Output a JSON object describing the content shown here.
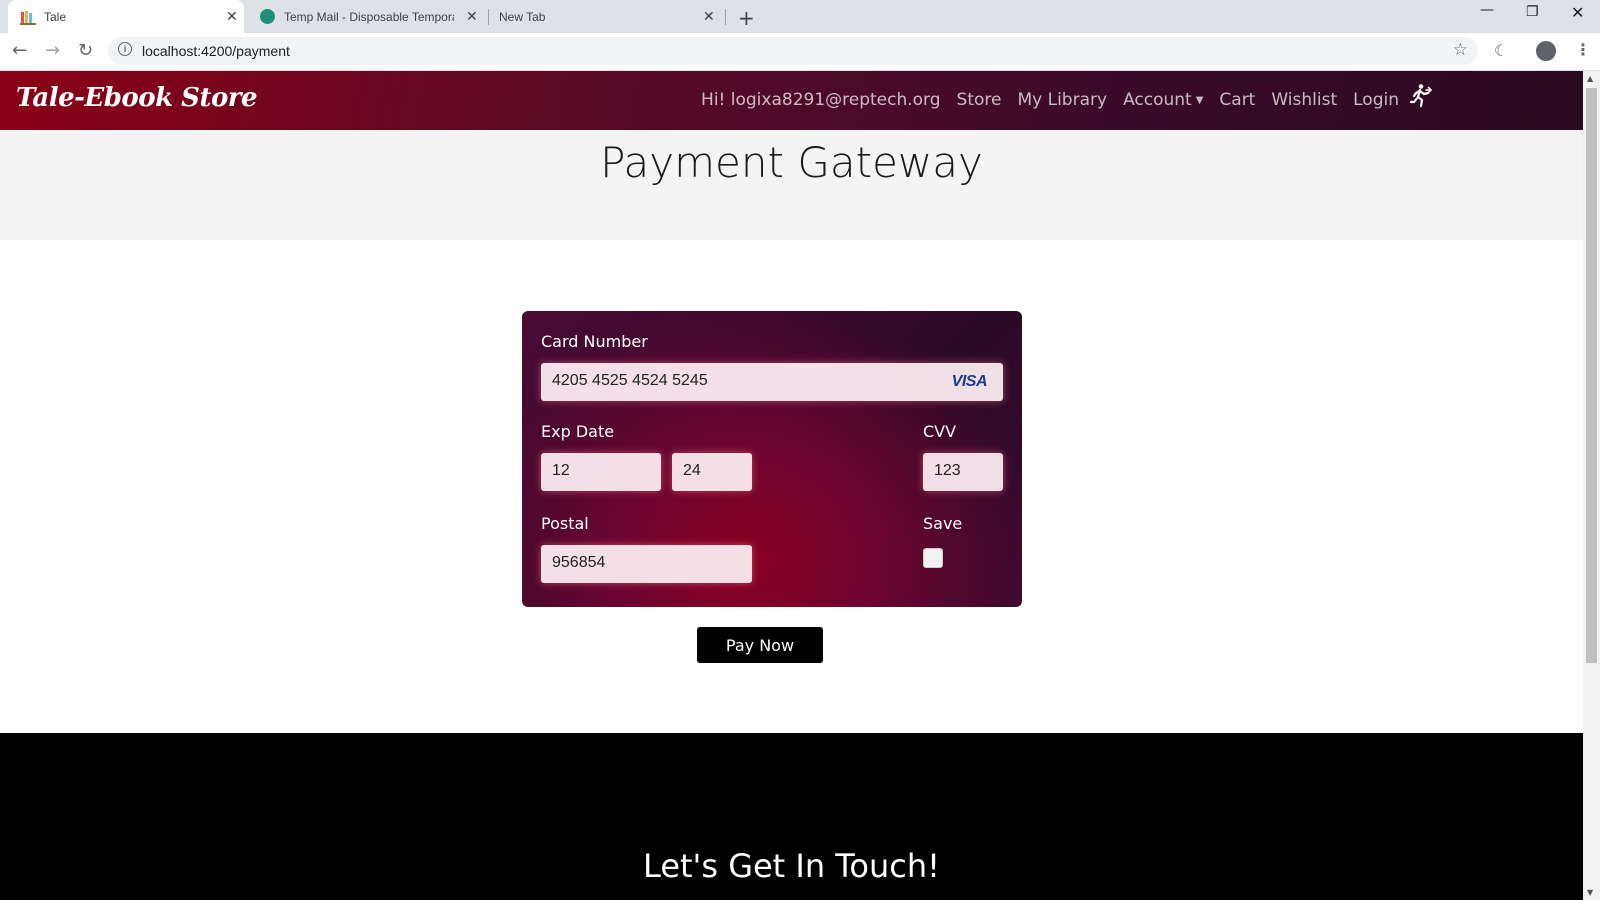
{
  "browser": {
    "tabs": [
      {
        "title": "Tale",
        "active": true
      },
      {
        "title": "Temp Mail - Disposable Tempora",
        "active": false
      },
      {
        "title": "New Tab",
        "active": false
      }
    ],
    "url": "localhost:4200/payment"
  },
  "site": {
    "brand": "Tale-Ebook Store",
    "nav": {
      "greeting": "Hi! logixa8291@reptech.org",
      "store": "Store",
      "library": "My Library",
      "account": "Account",
      "cart": "Cart",
      "wishlist": "Wishlist",
      "login": "Login"
    }
  },
  "page": {
    "title": "Payment Gateway"
  },
  "payment": {
    "card_number_label": "Card Number",
    "card_number": "4205 4525 4524 5245",
    "card_brand": "VISA",
    "exp_label": "Exp Date",
    "exp_month": "12",
    "exp_year": "24",
    "cvv_label": "CVV",
    "cvv": "123",
    "postal_label": "Postal",
    "postal": "956854",
    "save_label": "Save",
    "save_checked": false,
    "pay_button": "Pay Now"
  },
  "footer": {
    "heading": "Let's Get In Touch!"
  },
  "colors": {
    "nav_gradient_start": "#8b0016",
    "nav_gradient_end": "#2a0820",
    "card_dark": "#2b0a26",
    "card_glow": "#8a0022",
    "button": "#000000",
    "footer": "#000000"
  }
}
